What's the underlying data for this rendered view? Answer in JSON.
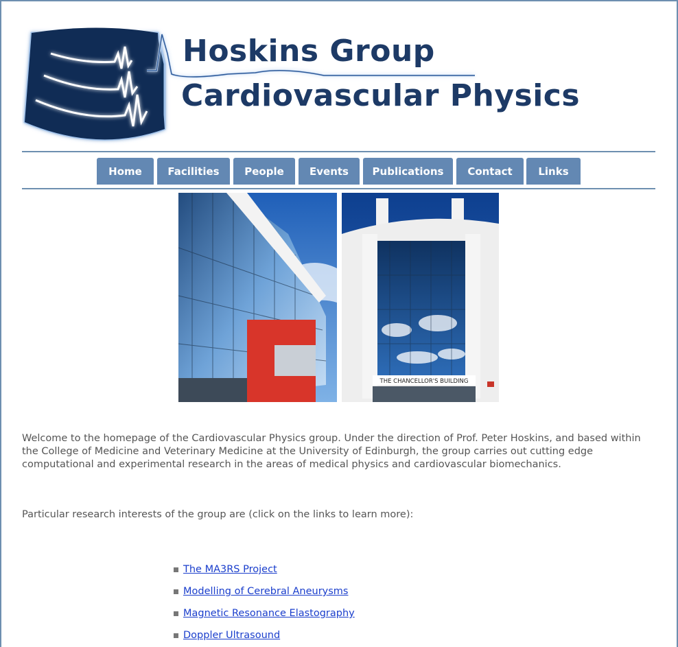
{
  "header": {
    "title_line1": "Hoskins Group",
    "title_line2": "Cardiovascular Physics"
  },
  "nav": {
    "items": [
      {
        "label": "Home"
      },
      {
        "label": "Facilities"
      },
      {
        "label": "People"
      },
      {
        "label": "Events"
      },
      {
        "label": "Publications"
      },
      {
        "label": "Contact"
      },
      {
        "label": "Links"
      }
    ]
  },
  "photos": {
    "right_sign": "THE CHANCELLOR'S BUILDING"
  },
  "content": {
    "intro": "Welcome to the homepage of the Cardiovascular Physics group. Under the direction of Prof. Peter Hoskins, and based within the College of Medicine and Veterinary Medicine at the University of Edinburgh, the group carries out cutting edge computational and experimental research in the areas of medical physics and cardiovascular biomechanics.",
    "interests_intro": "Particular research interests of the group are (click on the links to learn more):",
    "research_links": [
      "The MA3RS Project",
      "Modelling of Cerebral Aneurysms",
      "Magnetic Resonance Elastography",
      "Doppler Ultrasound"
    ]
  },
  "colors": {
    "nav_bg": "#6388b3",
    "logo_text": "#1d3a66",
    "link": "#1a3ecc"
  }
}
